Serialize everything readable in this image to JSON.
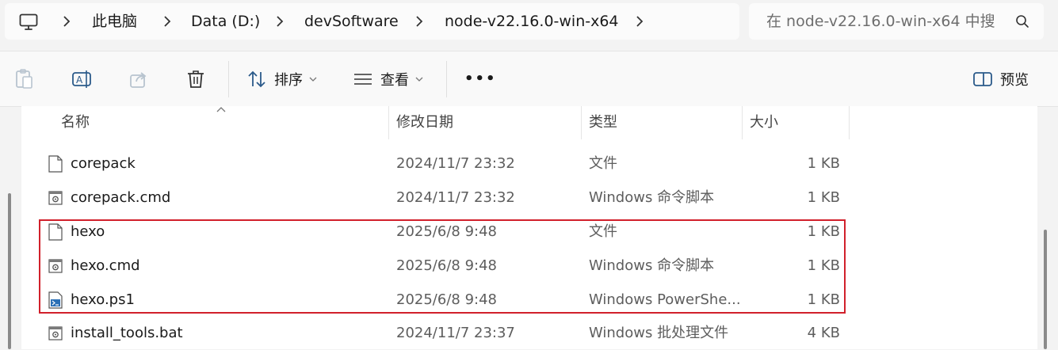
{
  "address": {
    "crumbs": [
      "此电脑",
      "Data (D:)",
      "devSoftware",
      "node-v22.16.0-win-x64"
    ]
  },
  "search": {
    "placeholder": "在 node-v22.16.0-win-x64 中搜"
  },
  "toolbar": {
    "sort_label": "排序",
    "view_label": "查看",
    "more_label": "•••",
    "preview_label": "预览"
  },
  "columns": {
    "name": "名称",
    "date": "修改日期",
    "type": "类型",
    "size": "大小"
  },
  "files": [
    {
      "name": "corepack",
      "date": "2024/11/7 23:32",
      "type": "文件",
      "size": "1 KB",
      "icon": "file-icon"
    },
    {
      "name": "corepack.cmd",
      "date": "2024/11/7 23:32",
      "type": "Windows 命令脚本",
      "size": "1 KB",
      "icon": "cmd-file-icon"
    },
    {
      "name": "hexo",
      "date": "2025/6/8 9:48",
      "type": "文件",
      "size": "1 KB",
      "icon": "file-icon"
    },
    {
      "name": "hexo.cmd",
      "date": "2025/6/8 9:48",
      "type": "Windows 命令脚本",
      "size": "1 KB",
      "icon": "cmd-file-icon"
    },
    {
      "name": "hexo.ps1",
      "date": "2025/6/8 9:48",
      "type": "Windows PowerShe...",
      "size": "1 KB",
      "icon": "powershell-file-icon"
    },
    {
      "name": "install_tools.bat",
      "date": "2024/11/7 23:37",
      "type": "Windows 批处理文件",
      "size": "4 KB",
      "icon": "bat-file-icon"
    }
  ],
  "colors": {
    "highlight": "#d1202b",
    "background": "#f3f3f3"
  }
}
